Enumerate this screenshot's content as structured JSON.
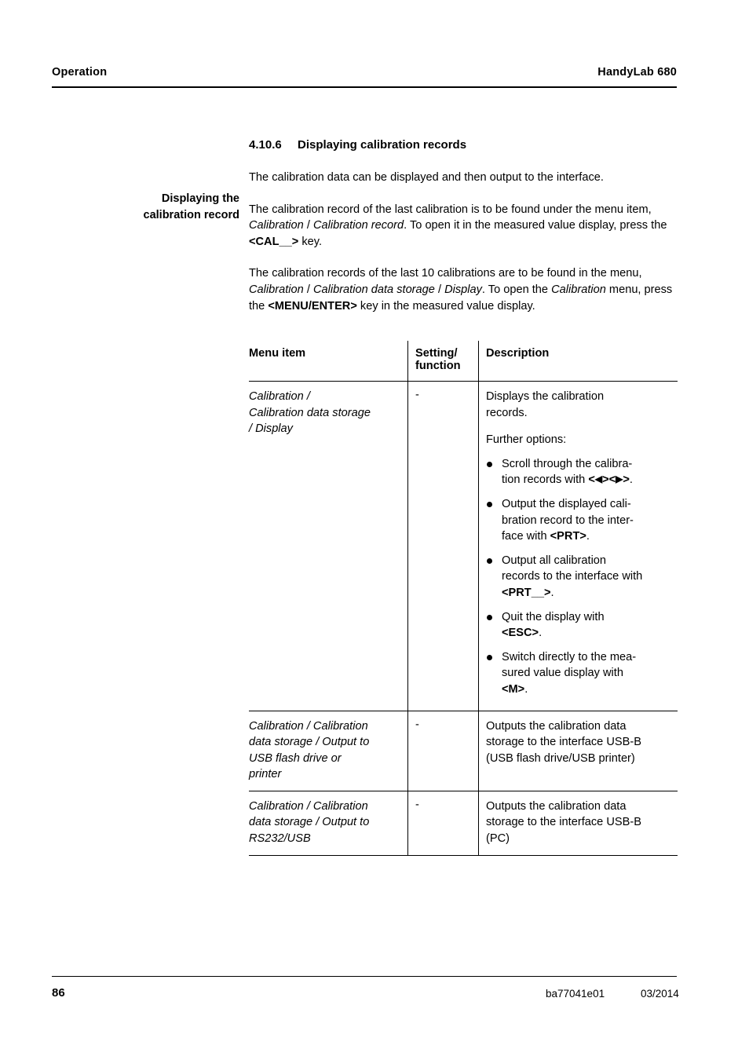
{
  "header": {
    "left": "Operation",
    "right": "HandyLab 680"
  },
  "footer": {
    "page_number": "86",
    "doc_id": "ba77041e01",
    "date": "03/2014"
  },
  "margin_note": {
    "line1": "Displaying the",
    "line2": "calibration record"
  },
  "section": {
    "number": "4.10.6",
    "title": "Displaying calibration records"
  },
  "paragraphs": {
    "p1": "The calibration data can be displayed and then output to the interface.",
    "p2_a": "The calibration record of the last calibration is to be found under the menu item, ",
    "p2_i1": "Calibration",
    "p2_b": " / ",
    "p2_i2": "Calibration record",
    "p2_c": ". To open it in the measured value display, press the ",
    "p2_key": "<CAL__>",
    "p2_d": " key.",
    "p3_a": "The calibration records of the last 10 calibrations are to be found in the menu, ",
    "p3_i1": "Calibration",
    "p3_b": " / ",
    "p3_i2": "Calibration data storage",
    "p3_c": " / ",
    "p3_i3": "Display",
    "p3_d": ". To open the ",
    "p3_i4": "Calibration",
    "p3_e": " menu, press the ",
    "p3_key": "<MENU/ENTER>",
    "p3_f": " key in the measured value display."
  },
  "table": {
    "headers": {
      "col1": "Menu item",
      "col2_line1": "Setting/",
      "col2_line2": "function",
      "col3": "Description"
    },
    "rows": [
      {
        "menu_item_lines": [
          "Calibration / ",
          "Calibration data storage",
          " / Display"
        ],
        "menu_item_plain": "Calibration / Calibration data storage / Display",
        "setting": "-",
        "description_intro_1": "Displays the calibration",
        "description_intro_2": "records.",
        "description_further": "Further options:",
        "bullets": [
          {
            "pre": "Scroll through the calibra-",
            "post_a": "tion records with ",
            "key_a": "<",
            "key_b": ">",
            "key_c": "<",
            "key_d": ">",
            "post_b": "."
          },
          {
            "text_1": "Output the displayed cali-",
            "text_2": "bration record to the inter-",
            "text_3a": "face with ",
            "key": "<PRT>",
            "text_3b": "."
          },
          {
            "text_1": "Output all calibration",
            "text_2": "records to the interface with",
            "key": "<PRT__>",
            "text_3b": "."
          },
          {
            "text_1": "Quit the display with",
            "key": "<ESC>",
            "text_3b": "."
          },
          {
            "text_1": "Switch directly to the mea-",
            "text_2": "sured value display with",
            "key": "<M>",
            "text_3b": "."
          }
        ]
      },
      {
        "menu_item_lines": [
          "Calibration / Calibration",
          "data storage / Output to",
          "USB flash drive or",
          "printer"
        ],
        "setting": "-",
        "description_lines": [
          "Outputs the calibration data",
          "storage to the interface USB-B",
          "(USB flash drive/USB printer)"
        ]
      },
      {
        "menu_item_lines": [
          "Calibration / Calibration",
          "data storage / Output to",
          "RS232/USB"
        ],
        "setting": "-",
        "description_lines": [
          "Outputs the calibration data",
          "storage to the interface USB-B",
          "(PC)"
        ]
      }
    ]
  }
}
